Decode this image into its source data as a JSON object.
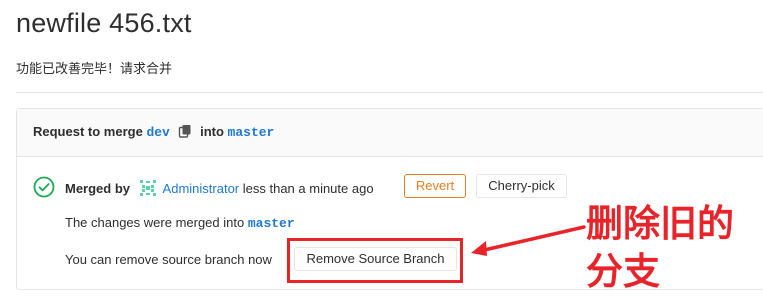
{
  "page": {
    "title": "newfile 456.txt",
    "description": "功能已改善完毕！请求合并"
  },
  "mr_header": {
    "prefix": "Request to merge",
    "source_branch": "dev",
    "copy_icon": "clipboard-icon",
    "into_label": "into",
    "target_branch": "master"
  },
  "merged_info": {
    "status_icon": "check-circle-icon",
    "status_color": "#1aaa55",
    "merged_by_label": "Merged by",
    "avatar_icon": "identicon-avatar",
    "author": "Administrator",
    "time": "less than a minute ago",
    "revert_label": "Revert",
    "cherry_pick_label": "Cherry-pick"
  },
  "merged_into": {
    "text": "The changes were merged into",
    "branch": "master"
  },
  "remove_branch": {
    "text": "You can remove source branch now",
    "button_label": "Remove Source Branch"
  },
  "annotation": {
    "text": "删除旧的\n分支",
    "color": "#e8242b"
  },
  "colors": {
    "link": "#1f78d1",
    "warning": "#e67e22",
    "border": "#e5e5e5",
    "header_bg": "#fafafa"
  }
}
